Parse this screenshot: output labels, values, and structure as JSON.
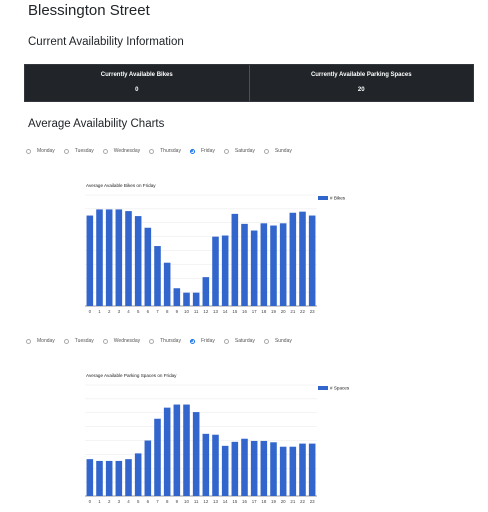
{
  "station": {
    "name": "Blessington Street"
  },
  "current": {
    "heading": "Current Availability Information",
    "bikes_label": "Currently Available Bikes",
    "bikes_value": "0",
    "spaces_label": "Currently Available Parking Spaces",
    "spaces_value": "20"
  },
  "averages": {
    "heading": "Average Availability Charts",
    "days": [
      "Monday",
      "Tuesday",
      "Wednesday",
      "Thursday",
      "Friday",
      "Saturday",
      "Sunday"
    ],
    "selected_day": "Friday"
  },
  "colors": {
    "bar": "#3366cc",
    "table_bg": "#212529",
    "radio_selected": "#1a73e8"
  },
  "chart_data": [
    {
      "type": "bar",
      "title": "Average Available Bikes on Friday",
      "categories": [
        "0",
        "1",
        "2",
        "3",
        "4",
        "5",
        "6",
        "7",
        "8",
        "9",
        "10",
        "11",
        "12",
        "13",
        "14",
        "15",
        "16",
        "17",
        "18",
        "19",
        "20",
        "21",
        "22",
        "23"
      ],
      "series": [
        {
          "name": "# Bikes",
          "values": [
            16.3,
            17.4,
            17.4,
            17.4,
            17.1,
            16.2,
            14.1,
            10.8,
            7.8,
            3.2,
            2.4,
            2.4,
            5.2,
            12.5,
            12.7,
            16.6,
            14.8,
            13.6,
            14.9,
            14.5,
            14.9,
            16.8,
            17.0,
            16.3
          ]
        }
      ],
      "ylim": [
        0,
        20
      ],
      "legend": "top-right",
      "grid": true
    },
    {
      "type": "bar",
      "title": "Average Available Parking Spaces on Friday",
      "categories": [
        "0",
        "1",
        "2",
        "3",
        "4",
        "5",
        "6",
        "7",
        "8",
        "9",
        "10",
        "11",
        "12",
        "13",
        "14",
        "15",
        "16",
        "17",
        "18",
        "19",
        "20",
        "21",
        "22",
        "23"
      ],
      "series": [
        {
          "name": "# Spaces",
          "values": [
            8.3,
            7.9,
            7.9,
            7.9,
            8.3,
            9.6,
            12.5,
            17.4,
            19.9,
            20.6,
            20.6,
            18.9,
            14.0,
            13.8,
            11.3,
            12.2,
            12.9,
            12.4,
            12.4,
            12.1,
            11.1,
            11.1,
            11.8,
            11.8
          ]
        }
      ],
      "ylim": [
        0,
        25
      ],
      "legend": "top-right",
      "grid": true
    }
  ]
}
